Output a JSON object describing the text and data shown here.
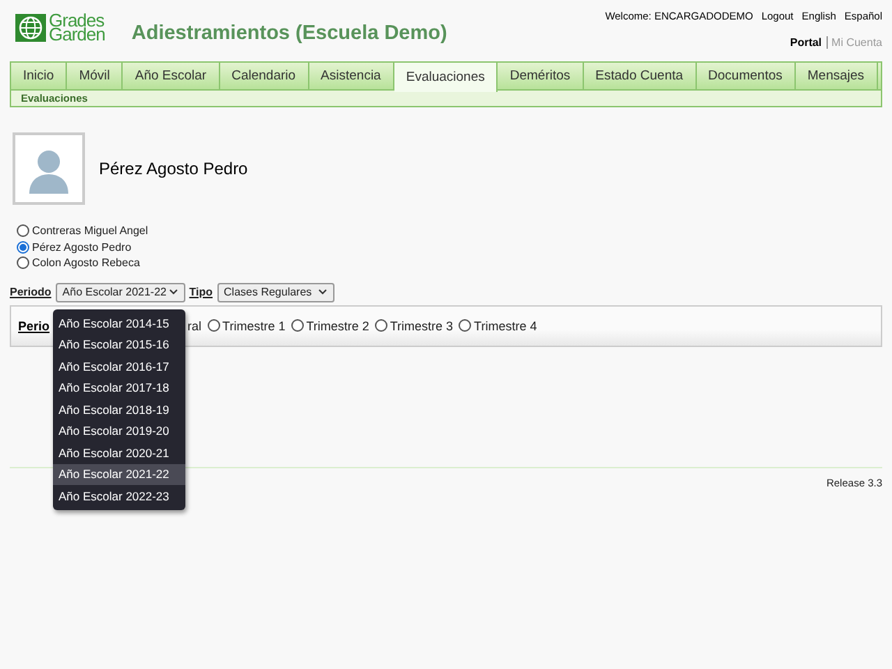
{
  "logo": {
    "line1": "Grades",
    "line2": "Garden"
  },
  "title": "Adiestramientos (Escuela Demo)",
  "top_links": {
    "welcome": "Welcome: ENCARGADODEMO",
    "links": [
      "Logout",
      "English",
      "Español"
    ]
  },
  "portal_links": [
    {
      "label": "Portal",
      "selected": true
    },
    {
      "label": "Mi Cuenta",
      "selected": false
    }
  ],
  "tabs": [
    {
      "label": "Inicio",
      "selected": false
    },
    {
      "label": "Móvil",
      "selected": false
    },
    {
      "label": "Año Escolar",
      "selected": false
    },
    {
      "label": "Calendario",
      "selected": false
    },
    {
      "label": "Asistencia",
      "selected": false
    },
    {
      "label": "Evaluaciones",
      "selected": true
    },
    {
      "label": "Deméritos",
      "selected": false
    },
    {
      "label": "Estado Cuenta",
      "selected": false
    },
    {
      "label": "Documentos",
      "selected": false
    },
    {
      "label": "Mensajes",
      "selected": false
    }
  ],
  "breadcrumb": "Evaluaciones",
  "student_name": "Pérez Agosto Pedro",
  "students": [
    {
      "label": "Contreras Miguel Angel",
      "selected": false
    },
    {
      "label": "Pérez Agosto Pedro",
      "selected": true
    },
    {
      "label": "Colon Agosto Rebeca",
      "selected": false
    }
  ],
  "period_label": "Periodo",
  "period_value": "Año Escolar 2021-22",
  "tipo_label": "Tipo",
  "tipo_value": "Clases Regulares",
  "panel": {
    "label": "Perio",
    "partial_option": "ral",
    "options": [
      {
        "label": "Trimestre 1",
        "selected": false
      },
      {
        "label": "Trimestre 2",
        "selected": false
      },
      {
        "label": "Trimestre 3",
        "selected": false
      },
      {
        "label": "Trimestre 4",
        "selected": false
      }
    ]
  },
  "dropdown": [
    {
      "label": "Año Escolar 2014-15",
      "selected": false
    },
    {
      "label": "Año Escolar 2015-16",
      "selected": false
    },
    {
      "label": "Año Escolar 2016-17",
      "selected": false
    },
    {
      "label": "Año Escolar 2017-18",
      "selected": false
    },
    {
      "label": "Año Escolar 2018-19",
      "selected": false
    },
    {
      "label": "Año Escolar 2019-20",
      "selected": false
    },
    {
      "label": "Año Escolar 2020-21",
      "selected": false
    },
    {
      "label": "Año Escolar 2021-22",
      "selected": true
    },
    {
      "label": "Año Escolar 2022-23",
      "selected": false
    }
  ],
  "release": "Release 3.3"
}
